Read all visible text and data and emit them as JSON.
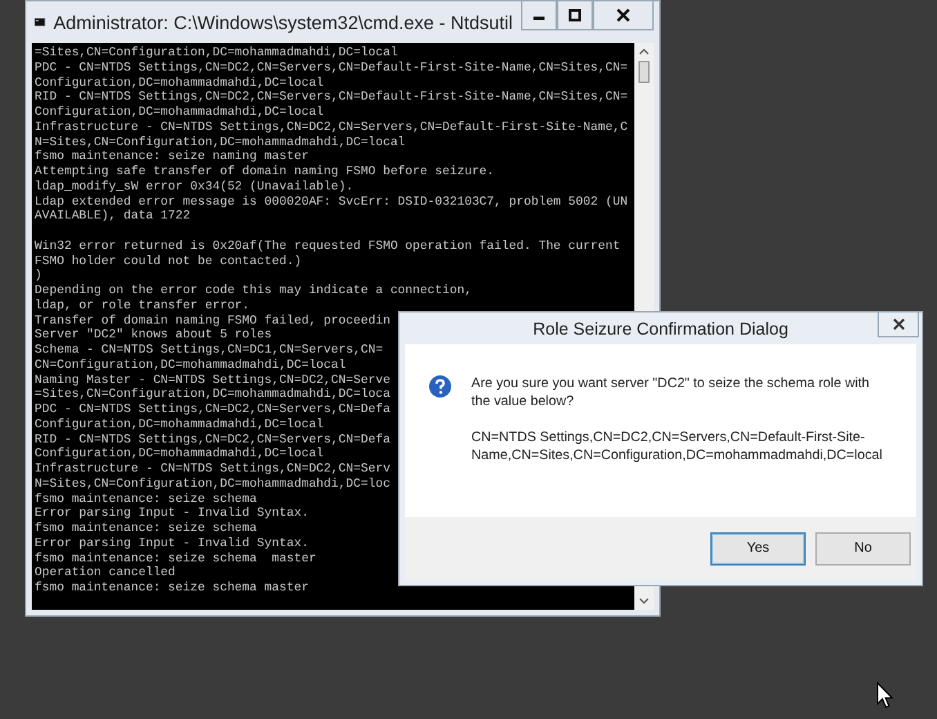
{
  "console_window": {
    "title": "Administrator: C:\\Windows\\system32\\cmd.exe - Ntdsutil",
    "blocks": [
      [
        "=Sites,CN=Configuration,DC=mohammadmahdi,DC=local",
        "PDC - CN=NTDS Settings,CN=DC2,CN=Servers,CN=Default-First-Site-Name,CN=Sites,CN=",
        "Configuration,DC=mohammadmahdi,DC=local",
        "RID - CN=NTDS Settings,CN=DC2,CN=Servers,CN=Default-First-Site-Name,CN=Sites,CN=",
        "Configuration,DC=mohammadmahdi,DC=local",
        "Infrastructure - CN=NTDS Settings,CN=DC2,CN=Servers,CN=Default-First-Site-Name,C",
        "N=Sites,CN=Configuration,DC=mohammadmahdi,DC=local",
        "fsmo maintenance: seize naming master",
        "Attempting safe transfer of domain naming FSMO before seizure.",
        "ldap_modify_sW error 0x34(52 (Unavailable).",
        "Ldap extended error message is 000020AF: SvcErr: DSID-032103C7, problem 5002 (UN",
        "AVAILABLE), data 1722"
      ],
      [
        "Win32 error returned is 0x20af(The requested FSMO operation failed. The current",
        "FSMO holder could not be contacted.)",
        ")",
        "Depending on the error code this may indicate a connection,",
        "ldap, or role transfer error.",
        "Transfer of domain naming FSMO failed, proceedin",
        "Server \"DC2\" knows about 5 roles",
        "Schema - CN=NTDS Settings,CN=DC1,CN=Servers,CN=",
        "CN=Configuration,DC=mohammadmahdi,DC=local",
        "Naming Master - CN=NTDS Settings,CN=DC2,CN=Serve",
        "=Sites,CN=Configuration,DC=mohammadmahdi,DC=loca",
        "PDC - CN=NTDS Settings,CN=DC2,CN=Servers,CN=Defa",
        "Configuration,DC=mohammadmahdi,DC=local",
        "RID - CN=NTDS Settings,CN=DC2,CN=Servers,CN=Defa",
        "Configuration,DC=mohammadmahdi,DC=local",
        "Infrastructure - CN=NTDS Settings,CN=DC2,CN=Serv",
        "N=Sites,CN=Configuration,DC=mohammadmahdi,DC=loc",
        "fsmo maintenance: seize schema",
        "Error parsing Input - Invalid Syntax.",
        "fsmo maintenance: seize schema",
        "Error parsing Input - Invalid Syntax.",
        "fsmo maintenance: seize schema  master",
        "Operation cancelled",
        "fsmo maintenance: seize schema master"
      ]
    ]
  },
  "dialog": {
    "title": "Role Seizure Confirmation Dialog",
    "message": "Are you sure you want server \"DC2\" to seize the schema role with the value below?",
    "value": "CN=NTDS Settings,CN=DC2,CN=Servers,CN=Default-First-Site-Name,CN=Sites,CN=Configuration,DC=mohammadmahdi,DC=local",
    "buttons": [
      {
        "label": "Yes",
        "default": true
      },
      {
        "label": "No",
        "default": false
      }
    ]
  }
}
